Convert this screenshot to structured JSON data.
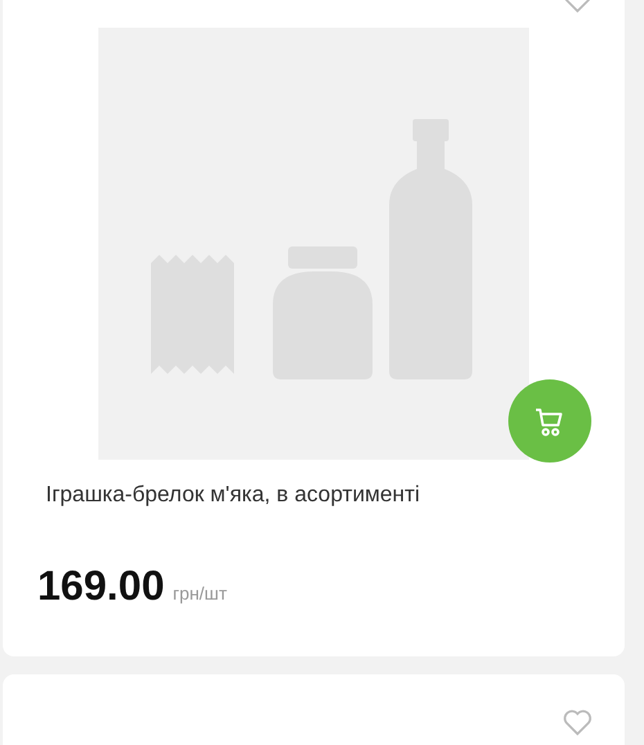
{
  "products": [
    {
      "kind": "full",
      "name": "Іграшка-брелок м'яка, в асортименті",
      "price": "169.00",
      "unit": "грн/шт"
    },
    {
      "kind": "cut"
    }
  ]
}
